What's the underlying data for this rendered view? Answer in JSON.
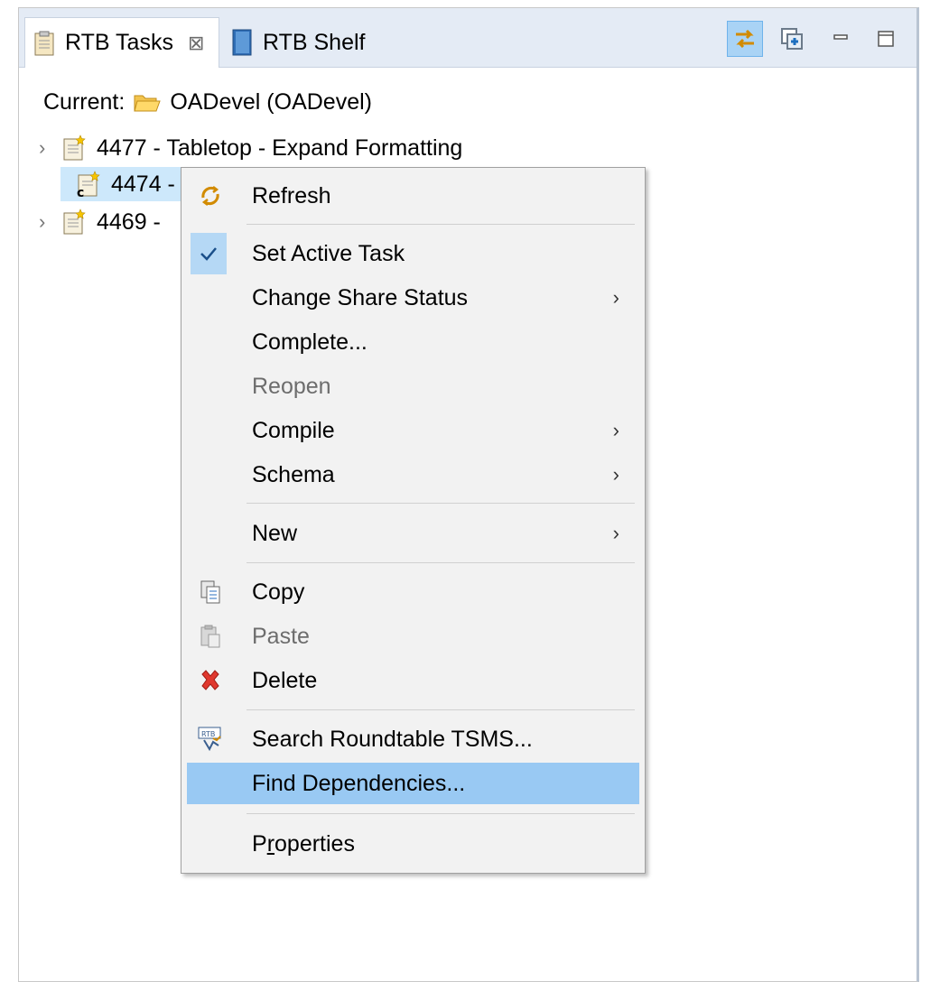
{
  "tabs": [
    {
      "label": "RTB Tasks",
      "close": "⊠",
      "active": true
    },
    {
      "label": "RTB Shelf",
      "active": false
    }
  ],
  "toolbar": {
    "sync": "sync-icon",
    "collapse": "collapse-all-icon",
    "minimize": "minimize-icon",
    "maximize": "maximize-icon"
  },
  "current": {
    "label": "Current:",
    "workspace": "OADevel (OADevel)"
  },
  "tasks": [
    {
      "text": "4477 - Tabletop - Expand Formatting",
      "expandable": true
    },
    {
      "text": "4474 - ",
      "expandable": false,
      "selected": true,
      "badge": "c"
    },
    {
      "text": "4469 - ",
      "expandable": true
    }
  ],
  "menu": {
    "refresh": "Refresh",
    "set_active": "Set Active Task",
    "change_share": "Change Share Status",
    "complete": "Complete...",
    "reopen": "Reopen",
    "compile": "Compile",
    "schema": "Schema",
    "new": "New",
    "copy": "Copy",
    "paste": "Paste",
    "delete": "Delete",
    "search": "Search Roundtable TSMS...",
    "find_deps": "Find Dependencies...",
    "properties_p": "P",
    "properties_u": "r",
    "properties_rest": "operties",
    "submenu_arrow": "›"
  },
  "colors": {
    "hover": "#99c9f3",
    "selected_row": "#cde8fb",
    "tabbar": "#e4ebf5",
    "delete": "#e0382e"
  }
}
